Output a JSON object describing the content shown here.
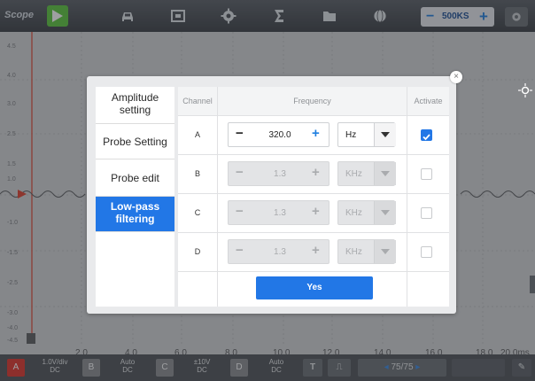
{
  "app": {
    "title": "Scope",
    "timebase": "500KS"
  },
  "plot": {
    "y_ticks": [
      "4.5",
      "4.0",
      "3.0",
      "2.5",
      "1.5",
      "1.0",
      "0",
      "-1.0",
      "-1.5",
      "-2.5",
      "-3.0",
      "-4.0",
      "-4.5"
    ],
    "x_ticks": [
      "2.0",
      "4.0",
      "6.0",
      "8.0",
      "10.0",
      "12.0",
      "14.0",
      "16.0",
      "18.0",
      "20.0ms"
    ],
    "trace_color": "#5b5d60",
    "cursor_color": "#e0412f"
  },
  "bottom": {
    "channels": [
      {
        "label": "A",
        "color": "#e0332b",
        "setting_line1": "1.0V/div",
        "setting_line2": "DC"
      },
      {
        "label": "B",
        "color": "#8a8d91",
        "setting_line1": "Auto",
        "setting_line2": "DC"
      },
      {
        "label": "C",
        "color": "#8a8d91",
        "setting_line1": "±10V",
        "setting_line2": "DC"
      },
      {
        "label": "D",
        "color": "#8a8d91",
        "setting_line1": "Auto",
        "setting_line2": "DC"
      }
    ],
    "page_counter": "75/75"
  },
  "dialog": {
    "sidebar": [
      {
        "label": "Amplitude setting",
        "active": false
      },
      {
        "label": "Probe Setting",
        "active": false
      },
      {
        "label": "Probe edit",
        "active": false
      },
      {
        "label": "Low-pass filtering",
        "active": true
      }
    ],
    "headers": {
      "channel": "Channel",
      "frequency": "Frequency",
      "activate": "Activate"
    },
    "rows": [
      {
        "channel": "A",
        "value": "320.0",
        "unit": "Hz",
        "enabled": true,
        "active": true
      },
      {
        "channel": "B",
        "value": "1.3",
        "unit": "KHz",
        "enabled": false,
        "active": false
      },
      {
        "channel": "C",
        "value": "1.3",
        "unit": "KHz",
        "enabled": false,
        "active": false
      },
      {
        "channel": "D",
        "value": "1.3",
        "unit": "KHz",
        "enabled": false,
        "active": false
      }
    ],
    "yes_label": "Yes",
    "close_glyph": "×",
    "accent": "#2277e6"
  }
}
